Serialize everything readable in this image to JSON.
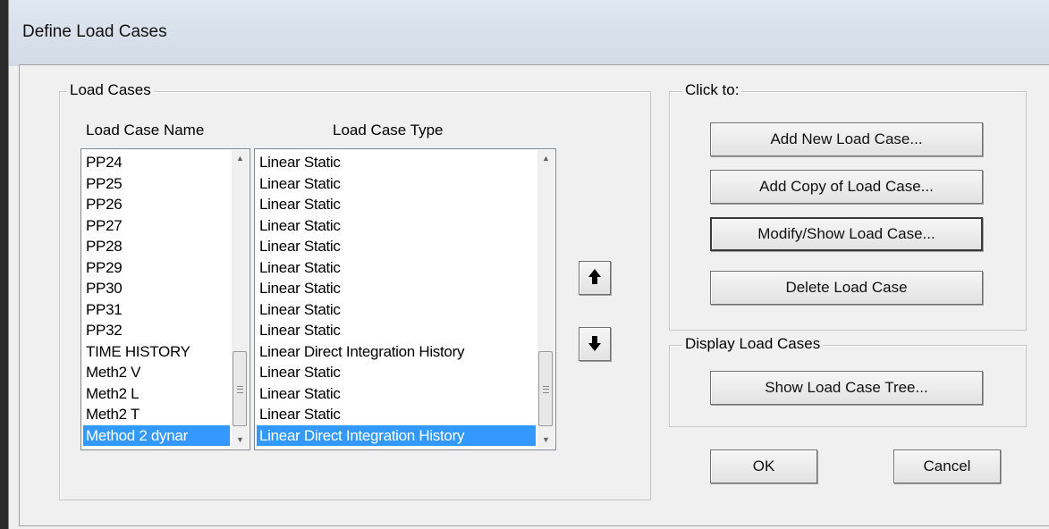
{
  "window": {
    "title": "Define Load Cases"
  },
  "load_cases": {
    "group_label": "Load Cases",
    "col_name_header": "Load Case Name",
    "col_type_header": "Load Case Type",
    "rows": [
      {
        "name": "PP24",
        "type": "Linear Static"
      },
      {
        "name": "PP25",
        "type": "Linear Static"
      },
      {
        "name": "PP26",
        "type": "Linear Static"
      },
      {
        "name": "PP27",
        "type": "Linear Static"
      },
      {
        "name": "PP28",
        "type": "Linear Static"
      },
      {
        "name": "PP29",
        "type": "Linear Static"
      },
      {
        "name": "PP30",
        "type": "Linear Static"
      },
      {
        "name": "PP31",
        "type": "Linear Static"
      },
      {
        "name": "PP32",
        "type": "Linear Static"
      },
      {
        "name": "TIME HISTORY",
        "type": "Linear Direct Integration History"
      },
      {
        "name": "Meth2 V",
        "type": "Linear Static"
      },
      {
        "name": "Meth2 L",
        "type": "Linear Static"
      },
      {
        "name": "Meth2 T",
        "type": "Linear Static"
      },
      {
        "name": "Method 2 dynar",
        "type": "Linear Direct Integration History",
        "selected": true
      }
    ]
  },
  "move_buttons": {
    "up_icon": "arrow-up-icon",
    "down_icon": "arrow-down-icon"
  },
  "click_to": {
    "group_label": "Click to:",
    "add_new": "Add New Load Case...",
    "add_copy": "Add Copy of Load Case...",
    "modify_show": "Modify/Show Load Case...",
    "delete": "Delete Load Case"
  },
  "display": {
    "group_label": "Display Load Cases",
    "show_tree": "Show Load Case Tree..."
  },
  "footer": {
    "ok": "OK",
    "cancel": "Cancel"
  },
  "colors": {
    "selection": "#3399ff",
    "dialog_bg": "#f0f0f0"
  }
}
